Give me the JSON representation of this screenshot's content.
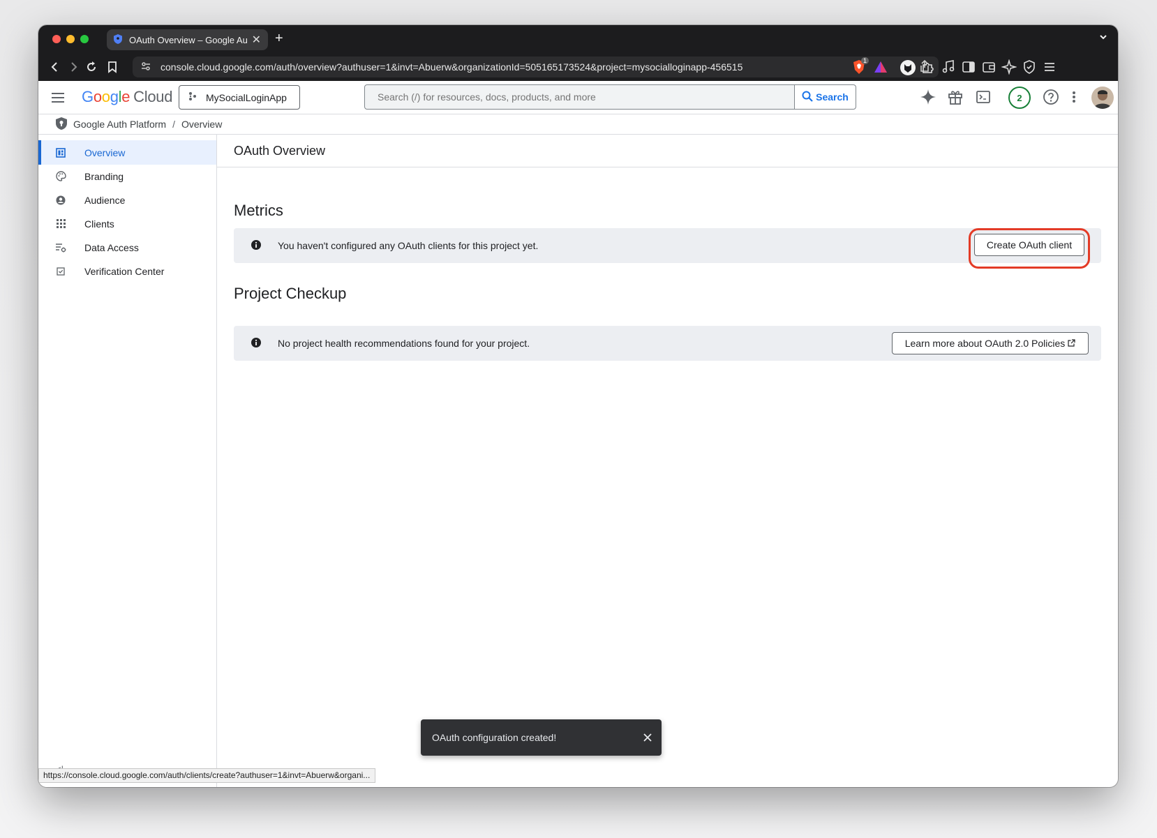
{
  "colors": {
    "accent": "#1a73e8",
    "active_nav_bg": "#e8f0fe",
    "highlight_ring": "#e33b27",
    "card_bg": "#eceef2",
    "badge_green": "#188038"
  },
  "browser": {
    "tab": {
      "title": "OAuth Overview – Google Auth Platform",
      "icon": "shield-icon"
    },
    "url": "console.cloud.google.com/auth/overview?authuser=1&invt=Abuerw&organizationId=505165173524&project=mysocialloginapp-456515",
    "extension_badge": "1",
    "status_url": "https://console.cloud.google.com/auth/clients/create?authuser=1&invt=Abuerw&organi..."
  },
  "header": {
    "logo": {
      "google": "Google",
      "cloud": "Cloud"
    },
    "project": "MySocialLoginApp",
    "search": {
      "placeholder": "Search (/) for resources, docs, products, and more",
      "button": "Search"
    },
    "notifications_count": "2",
    "icons": [
      "gemini-icon",
      "gift-icon",
      "cloud-shell-icon",
      "help-icon",
      "more-vert-icon"
    ]
  },
  "breadcrumb": {
    "root": "Google Auth Platform",
    "separator": "/",
    "current": "Overview"
  },
  "sidebar": {
    "items": [
      {
        "label": "Overview",
        "icon": "dashboard-icon",
        "active": true
      },
      {
        "label": "Branding",
        "icon": "palette-icon",
        "active": false
      },
      {
        "label": "Audience",
        "icon": "person-circle-icon",
        "active": false
      },
      {
        "label": "Clients",
        "icon": "apps-grid-icon",
        "active": false
      },
      {
        "label": "Data Access",
        "icon": "data-settings-icon",
        "active": false
      },
      {
        "label": "Verification Center",
        "icon": "checkbox-icon",
        "active": false
      }
    ]
  },
  "main": {
    "title": "OAuth Overview",
    "metrics": {
      "heading": "Metrics",
      "message": "You haven't configured any OAuth clients for this project yet.",
      "button": "Create OAuth client"
    },
    "checkup": {
      "heading": "Project Checkup",
      "message": "No project health recommendations found for your project.",
      "link": "Learn more about OAuth 2.0 Policies"
    }
  },
  "toast": {
    "message": "OAuth configuration created!"
  }
}
